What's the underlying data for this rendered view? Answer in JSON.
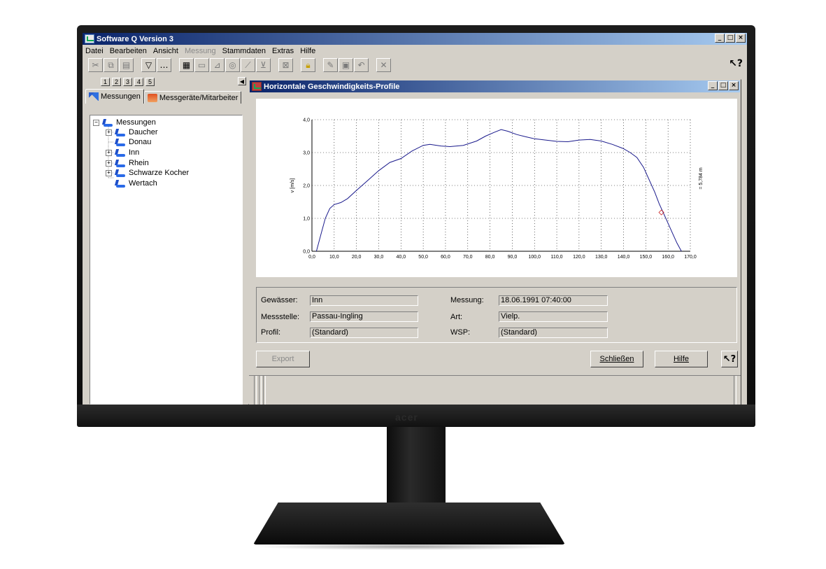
{
  "app": {
    "title": "Software Q Version 3",
    "menu": [
      {
        "label": "Datei",
        "enabled": true
      },
      {
        "label": "Bearbeiten",
        "enabled": true
      },
      {
        "label": "Ansicht",
        "enabled": true
      },
      {
        "label": "Messung",
        "enabled": false
      },
      {
        "label": "Stammdaten",
        "enabled": true
      },
      {
        "label": "Extras",
        "enabled": true
      },
      {
        "label": "Hilfe",
        "enabled": true
      }
    ],
    "window_buttons": [
      "_",
      "□",
      "×"
    ],
    "help_button": "?"
  },
  "left_pane": {
    "num_tabs": [
      "1",
      "2",
      "3",
      "4",
      "5"
    ],
    "tabs": [
      "Messungen",
      "Messgeräte/Mitarbeiter"
    ],
    "tree": {
      "root": "Messungen",
      "children": [
        {
          "label": "Daucher",
          "expandable": true
        },
        {
          "label": "Donau",
          "expandable": false
        },
        {
          "label": "Inn",
          "expandable": true
        },
        {
          "label": "Rhein",
          "expandable": true
        },
        {
          "label": "Schwarze Kocher",
          "expandable": true
        },
        {
          "label": "Wertach",
          "expandable": false
        }
      ]
    }
  },
  "child_window": {
    "title": "Horizontale Geschwindigkeits-Profile",
    "fields": {
      "gewaesser_label": "Gewässer:",
      "gewaesser_value": "Inn",
      "messstelle_label": "Messstelle:",
      "messstelle_value": "Passau-Ingling",
      "profil_label": "Profil:",
      "profil_value": "(Standard)",
      "messung_label": "Messung:",
      "messung_value": "18.06.1991 07:40:00",
      "art_label": "Art:",
      "art_value": "Vielp.",
      "wsp_label": "WSP:",
      "wsp_value": "(Standard)"
    },
    "buttons": {
      "export": "Export",
      "close": "Schließen",
      "help": "Hilfe",
      "whats_this": "?"
    }
  },
  "chart_data": {
    "type": "line",
    "ylabel": "v [m/s]",
    "right_label": "= 5,784 m",
    "xlim": [
      0,
      170
    ],
    "ylim": [
      0,
      4
    ],
    "x_ticks": [
      "0,0",
      "10,0",
      "20,0",
      "30,0",
      "40,0",
      "50,0",
      "60,0",
      "70,0",
      "80,0",
      "90,0",
      "100,0",
      "110,0",
      "120,0",
      "130,0",
      "140,0",
      "150,0",
      "160,0",
      "170,0"
    ],
    "y_ticks": [
      "0,0",
      "1,0",
      "2,0",
      "3,0",
      "4,0"
    ],
    "grid": true,
    "line_color": "#1a1a8c",
    "marker_color": "#cc2222",
    "marker": {
      "x": 157,
      "y": 1.18
    },
    "series": [
      {
        "x": [
          2,
          4,
          6,
          8,
          10,
          13,
          16,
          20,
          25,
          30,
          35,
          40,
          45,
          50,
          53,
          58,
          62,
          68,
          74,
          78,
          82,
          85,
          88,
          92,
          96,
          100,
          105,
          110,
          115,
          120,
          125,
          130,
          135,
          140,
          143,
          146,
          149,
          152,
          154,
          156,
          158,
          160,
          162,
          164,
          166
        ],
        "y": [
          0.0,
          0.5,
          1.0,
          1.3,
          1.42,
          1.48,
          1.6,
          1.85,
          2.15,
          2.45,
          2.7,
          2.82,
          3.05,
          3.22,
          3.25,
          3.2,
          3.18,
          3.22,
          3.35,
          3.5,
          3.62,
          3.7,
          3.65,
          3.55,
          3.48,
          3.42,
          3.38,
          3.34,
          3.33,
          3.38,
          3.4,
          3.35,
          3.25,
          3.12,
          3.0,
          2.85,
          2.55,
          2.1,
          1.8,
          1.45,
          1.15,
          0.85,
          0.55,
          0.25,
          0.0
        ]
      }
    ]
  }
}
